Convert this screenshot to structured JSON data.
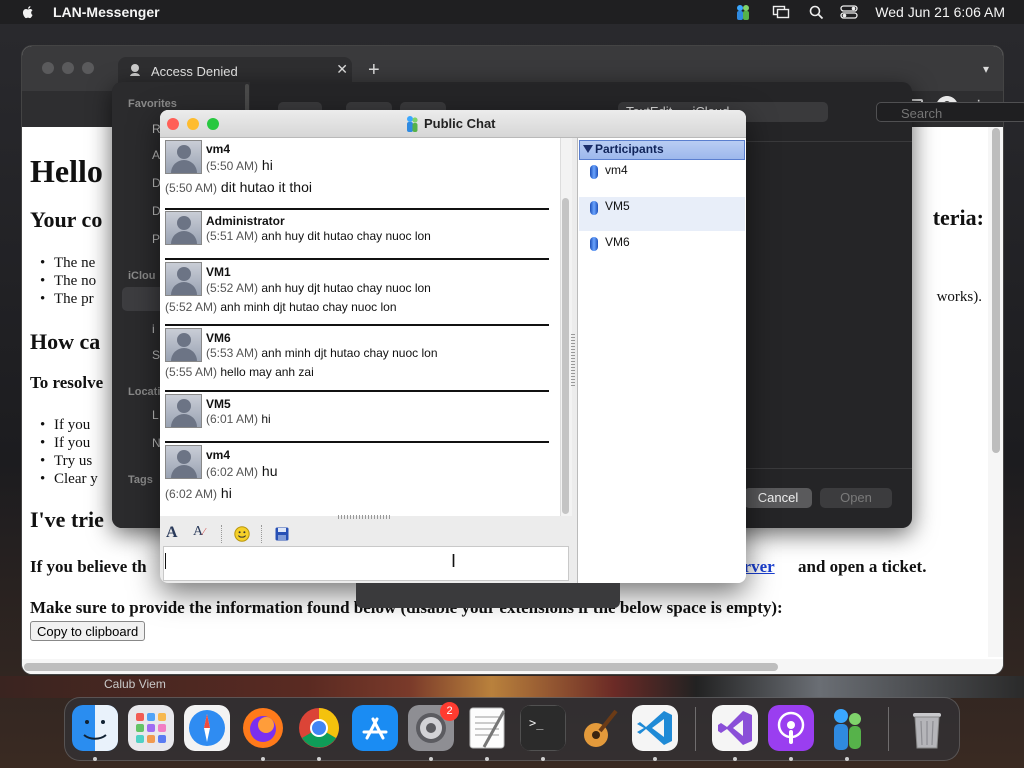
{
  "menubar": {
    "app_name": "LAN-Messenger",
    "clock": "Wed Jun 21  6:06 AM",
    "icons": [
      "apple-icon",
      "lan-messenger-status-icon",
      "screen-mirroring-icon",
      "spotlight-search-icon",
      "control-center-icon"
    ]
  },
  "browser": {
    "tab_title": "Access Denied",
    "new_tab_label": "+",
    "tab_list_icon": "chevron-down-icon",
    "nav_icons": [
      "back-arrow-icon",
      "forward-arrow-icon",
      "reload-icon"
    ],
    "page": {
      "h1": "Hello",
      "h2_left": "Your co",
      "h2_right": "teria:",
      "bullets_1": [
        "The ne",
        "The no",
        "The pr"
      ],
      "bullet_right": "works).",
      "h2_how": "How ca",
      "h3_resolve": "To resolve",
      "bullets_2": [
        "If you",
        "If you",
        "Try us",
        "Clear y"
      ],
      "h2_tried": "I've trie",
      "believe_prefix": "If you believe th",
      "server_link": "erver",
      "ticket_text": "and open a ticket.",
      "provide_text": "Make sure to provide the information found below (disable your extensions if the below space is empty):",
      "copy_button": "Copy to clipboard"
    }
  },
  "file_dialog": {
    "sidebar_sections": [
      "Favorites",
      "iClou",
      "Locati",
      "Tags"
    ],
    "location_field": "TextEdit — iCloud",
    "search_placeholder": "Search",
    "cancel_button": "Cancel",
    "open_button": "Open"
  },
  "chat": {
    "title": "Public Chat",
    "messages": [
      {
        "sender": "vm4",
        "lines": [
          {
            "time": "(5:50 AM)",
            "text": "hi",
            "big": true
          },
          {
            "time": "(5:50 AM)",
            "text": "dit hutao it thoi",
            "big": true
          }
        ]
      },
      {
        "sender": "Administrator",
        "lines": [
          {
            "time": "(5:51 AM)",
            "text": "anh huy dit hutao chay nuoc lon",
            "big": false
          }
        ]
      },
      {
        "sender": "VM1",
        "lines": [
          {
            "time": "(5:52 AM)",
            "text": "anh huy djt hutao chay nuoc lon",
            "big": false
          },
          {
            "time": "(5:52 AM)",
            "text": "anh minh djt hutao chay nuoc lon",
            "big": false
          }
        ]
      },
      {
        "sender": "VM6",
        "lines": [
          {
            "time": "(5:53 AM)",
            "text": "anh minh djt hutao chay nuoc lon",
            "big": false
          },
          {
            "time": "(5:55 AM)",
            "text": "hello may anh zai",
            "big": false
          }
        ]
      },
      {
        "sender": "VM5",
        "lines": [
          {
            "time": "(6:01 AM)",
            "text": "hi",
            "big": false
          }
        ]
      },
      {
        "sender": "vm4",
        "lines": [
          {
            "time": "(6:02 AM)",
            "text": "hu",
            "big": true
          },
          {
            "time": "(6:02 AM)",
            "text": "hi",
            "big": true
          }
        ]
      }
    ],
    "format_bar": [
      "font-icon",
      "text-color-icon",
      "smiley-icon",
      "save-icon"
    ],
    "input_value": "",
    "participants_title": "Participants",
    "participants": [
      "vm4",
      "VM5",
      "VM6"
    ]
  },
  "wallpaper_caption": "Calub Viem",
  "dock": {
    "apps": [
      "Finder",
      "Launchpad",
      "Safari",
      "Firefox",
      "Google Chrome",
      "App Store",
      "System Settings",
      "TextEdit",
      "Terminal",
      "GarageBand",
      "Visual Studio Code",
      "Visual Studio",
      "Podcasts",
      "LAN Messenger",
      "Trash"
    ],
    "settings_badge": "2"
  }
}
